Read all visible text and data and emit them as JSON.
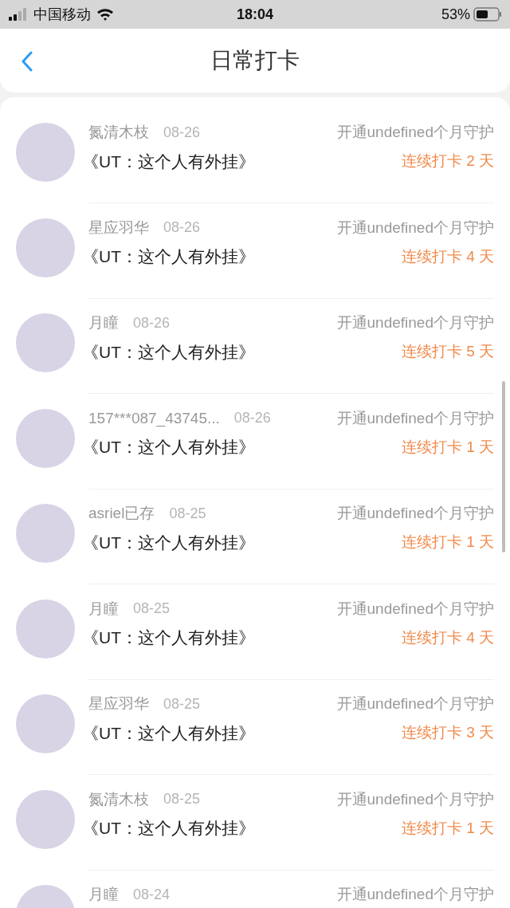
{
  "status_bar": {
    "carrier": "中国移动",
    "time": "18:04",
    "battery": "53%"
  },
  "header": {
    "title": "日常打卡"
  },
  "rows": [
    {
      "name": "氮清木枝",
      "date": "08-26",
      "guard": "开通undefined个月守护",
      "title": "《UT：这个人有外挂》",
      "streak": "连续打卡 2 天"
    },
    {
      "name": "星应羽华",
      "date": "08-26",
      "guard": "开通undefined个月守护",
      "title": "《UT：这个人有外挂》",
      "streak": "连续打卡 4 天"
    },
    {
      "name": "月瞳",
      "date": "08-26",
      "guard": "开通undefined个月守护",
      "title": "《UT：这个人有外挂》",
      "streak": "连续打卡 5 天"
    },
    {
      "name": "157***087_43745...",
      "date": "08-26",
      "guard": "开通undefined个月守护",
      "title": "《UT：这个人有外挂》",
      "streak": "连续打卡 1 天"
    },
    {
      "name": "asriel已存",
      "date": "08-25",
      "guard": "开通undefined个月守护",
      "title": "《UT：这个人有外挂》",
      "streak": "连续打卡 1 天"
    },
    {
      "name": "月瞳",
      "date": "08-25",
      "guard": "开通undefined个月守护",
      "title": "《UT：这个人有外挂》",
      "streak": "连续打卡 4 天"
    },
    {
      "name": "星应羽华",
      "date": "08-25",
      "guard": "开通undefined个月守护",
      "title": "《UT：这个人有外挂》",
      "streak": "连续打卡 3 天"
    },
    {
      "name": "氮清木枝",
      "date": "08-25",
      "guard": "开通undefined个月守护",
      "title": "《UT：这个人有外挂》",
      "streak": "连续打卡 1 天"
    },
    {
      "name": "月瞳",
      "date": "08-24",
      "guard": "开通undefined个月守护"
    }
  ]
}
